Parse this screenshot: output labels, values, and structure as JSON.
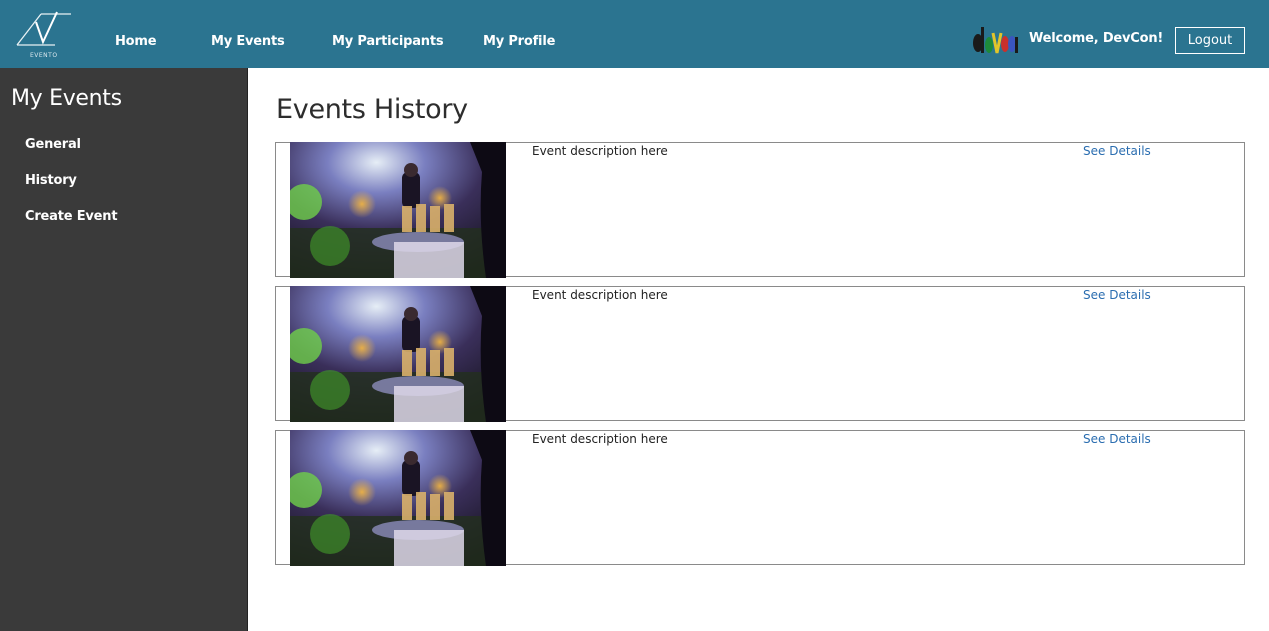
{
  "header": {
    "logo_text": "EVENTO",
    "nav": [
      {
        "label": "Home"
      },
      {
        "label": "My Events"
      },
      {
        "label": "My Participants"
      },
      {
        "label": "My Profile"
      }
    ],
    "welcome": "Welcome, DevCon!",
    "logout_label": "Logout",
    "colors": {
      "bar": "#2b7490"
    }
  },
  "sidebar": {
    "title": "My Events",
    "items": [
      {
        "label": "General"
      },
      {
        "label": "History"
      },
      {
        "label": "Create Event"
      }
    ]
  },
  "main": {
    "title": "Events History",
    "events": [
      {
        "description": "Event description here",
        "link": "See Details"
      },
      {
        "description": "Event description here",
        "link": "See Details"
      },
      {
        "description": "Event description here",
        "link": "See Details"
      }
    ]
  }
}
